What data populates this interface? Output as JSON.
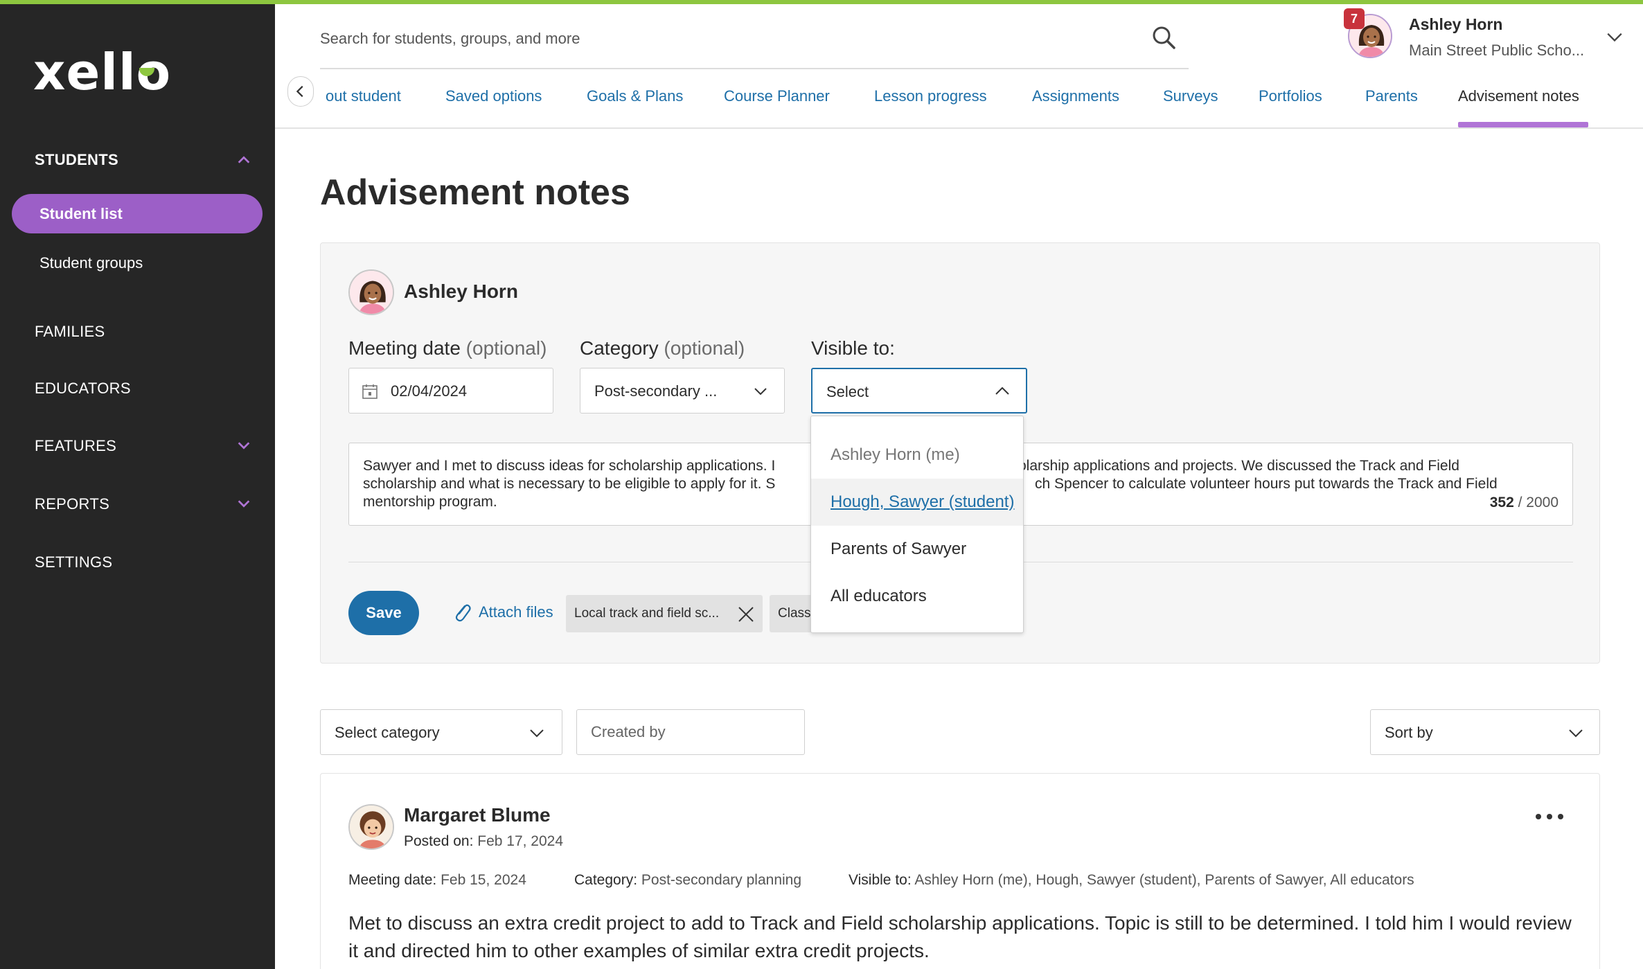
{
  "app": {
    "logo_text": "xello",
    "accent_color": "#8dc63f",
    "purple": "#9c5fc7",
    "blue": "#1e6fa8"
  },
  "sidebar": {
    "students_label": "STUDENTS",
    "student_list": "Student list",
    "student_groups": "Student groups",
    "families": "FAMILIES",
    "educators": "EDUCATORS",
    "features": "FEATURES",
    "reports": "REPORTS",
    "settings": "SETTINGS"
  },
  "search": {
    "placeholder": "Search for students, groups, and more"
  },
  "profile": {
    "name": "Ashley Horn",
    "school": "Main Street Public Scho...",
    "notifications": "7"
  },
  "tabs": {
    "items": [
      "out student",
      "Saved options",
      "Goals & Plans",
      "Course Planner",
      "Lesson progress",
      "Assignments",
      "Surveys",
      "Portfolios",
      "Parents",
      "Advisement notes"
    ],
    "active": "Advisement notes"
  },
  "page": {
    "title": "Advisement notes"
  },
  "form": {
    "author": "Ashley Horn",
    "meeting_date_label": "Meeting date",
    "optional": "(optional)",
    "meeting_date_value": "02/04/2024",
    "category_label": "Category",
    "category_value": "Post-secondary ...",
    "visible_label": "Visible to:",
    "visible_value": "Select",
    "note_line1": "Sawyer and I met to discuss ideas for scholarship applications. I",
    "note_line1b": "olarship applications and projects. We discussed the Track and Field",
    "note_line2": "scholarship and what is necessary to be eligible to apply for it. S",
    "note_line2b": "ch Spencer to calculate volunteer hours put towards the Track and Field",
    "note_line3": "mentorship program.",
    "counter_used": "352",
    "counter_sep": " / ",
    "counter_max": "2000",
    "save": "Save",
    "attach": "Attach files",
    "attachments": [
      "Local track and field sc...",
      "Class"
    ]
  },
  "dropdown": {
    "options": [
      "Ashley Horn (me)",
      "Hough, Sawyer (student)",
      "Parents of Sawyer",
      "All educators"
    ]
  },
  "filters": {
    "category": "Select category",
    "created_by_placeholder": "Created by",
    "sort": "Sort by"
  },
  "note": {
    "author": "Margaret Blume",
    "posted_label": "Posted on:",
    "posted_value": "Feb 17, 2024",
    "meeting_label": "Meeting date:",
    "meeting_value": "Feb 15, 2024",
    "category_label": "Category:",
    "category_value": "Post-secondary planning",
    "visible_label": "Visible to:",
    "visible_value": "Ashley Horn (me), Hough, Sawyer (student), Parents of Sawyer, All educators",
    "body": "Met to discuss an extra credit project to add to Track and Field scholarship applications. Topic is still to be determined. I told him I would review it and directed him to other examples of similar extra credit projects."
  }
}
